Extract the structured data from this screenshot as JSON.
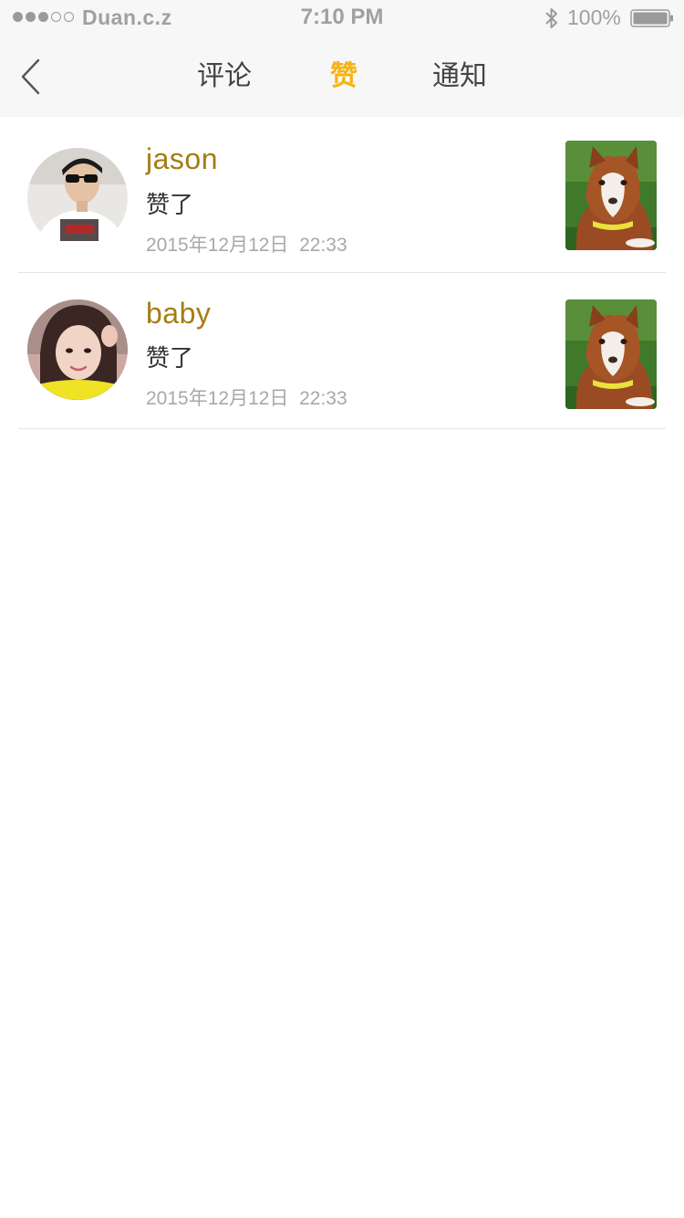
{
  "status_bar": {
    "carrier": "Duan.c.z",
    "time": "7:10 PM",
    "battery": "100%",
    "signal_dots": [
      true,
      true,
      true,
      false,
      false
    ],
    "icons": [
      "bluetooth-icon",
      "battery-icon"
    ]
  },
  "nav": {
    "back_icon": "chevron-left-icon",
    "tabs": [
      {
        "label": "评论",
        "active": false
      },
      {
        "label": "赞",
        "active": true
      },
      {
        "label": "通知",
        "active": false
      }
    ]
  },
  "likes": [
    {
      "username": "jason",
      "action": "赞了",
      "time": "2015年12月12日  22:33",
      "avatar": "user-avatar",
      "thumbnail": "dog-photo-thumbnail"
    },
    {
      "username": "baby",
      "action": "赞了",
      "time": "2015年12月12日  22:33",
      "avatar": "user-avatar",
      "thumbnail": "dog-photo-thumbnail"
    }
  ],
  "colors": {
    "accent": "#f5b412",
    "username": "#a67c12",
    "bar_background": "#f7f7f7",
    "divider": "#e5e5e5"
  }
}
